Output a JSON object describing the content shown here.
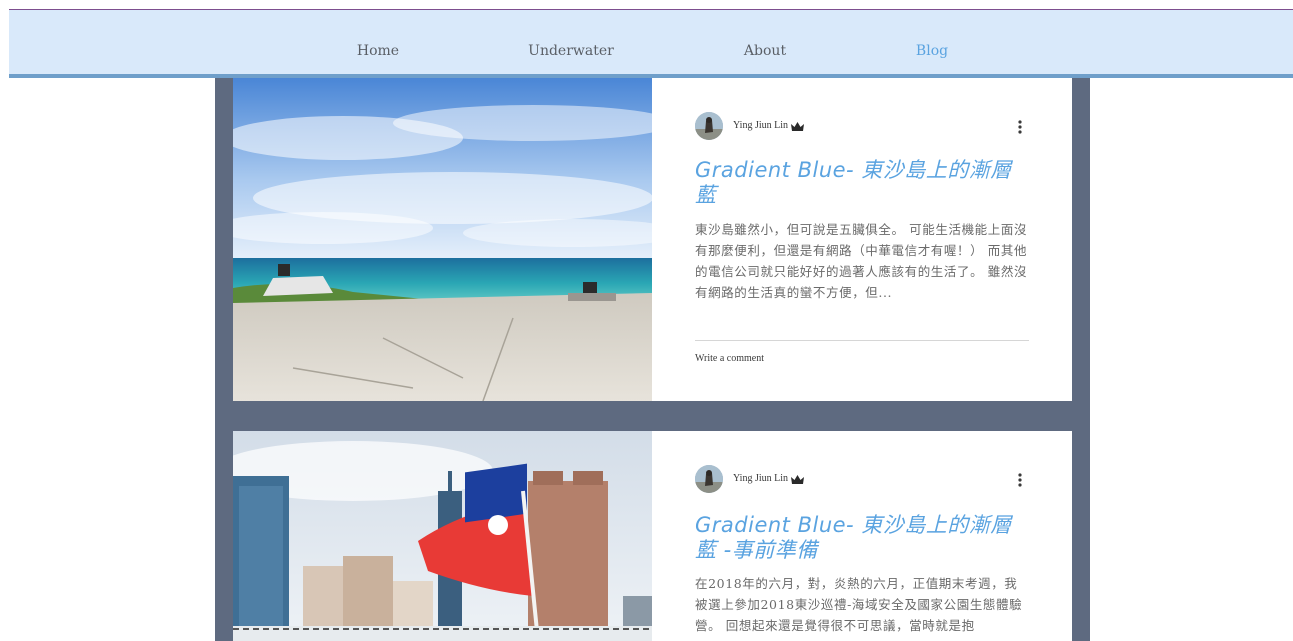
{
  "nav": {
    "items": [
      {
        "label": "Home",
        "active": false
      },
      {
        "label": "Underwater",
        "active": false
      },
      {
        "label": "About",
        "active": false
      },
      {
        "label": "Blog",
        "active": true
      }
    ]
  },
  "posts": [
    {
      "author": "Ying Jiun Lin",
      "author_badge_icon": "crown-icon",
      "title": "Gradient Blue- 東沙島上的漸層藍",
      "excerpt": "東沙島雖然小，但可說是五臟俱全。 可能生活機能上面沒有那麼便利，但還是有網路（中華電信才有喔！） 而其他的電信公司就只能好好的過著人應該有的生活了。 雖然沒有網路的生活真的蠻不方便，但...",
      "comment_link": "Write a comment",
      "more_icon": "more-vertical-icon"
    },
    {
      "author": "Ying Jiun Lin",
      "author_badge_icon": "crown-icon",
      "title": "Gradient Blue- 東沙島上的漸層藍 -事前準備",
      "excerpt": "在2018年的六月，對，炎熱的六月，正值期末考週，我被選上參加2018東沙巡禮-海域安全及國家公園生態體驗營。 回想起來還是覺得很不可思議，當時就是抱",
      "more_icon": "more-vertical-icon"
    }
  ],
  "colors": {
    "nav_bg": "#d9e9fa",
    "nav_border": "#6f9fca",
    "accent": "#5aa3e0",
    "feed_bg": "#5e6a80"
  }
}
